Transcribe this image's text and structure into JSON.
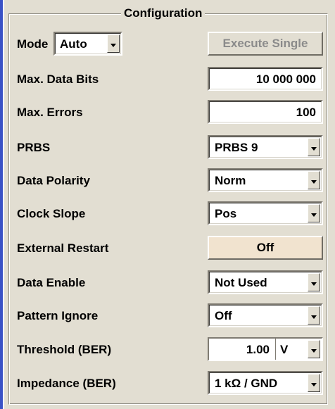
{
  "group": {
    "title": "Configuration"
  },
  "mode": {
    "label": "Mode",
    "value": "Auto"
  },
  "execute_single": {
    "label": "Execute Single"
  },
  "max_data_bits": {
    "label": "Max. Data Bits",
    "value": "10 000 000"
  },
  "max_errors": {
    "label": "Max. Errors",
    "value": "100"
  },
  "prbs": {
    "label": "PRBS",
    "value": "PRBS 9"
  },
  "data_polarity": {
    "label": "Data Polarity",
    "value": "Norm"
  },
  "clock_slope": {
    "label": "Clock Slope",
    "value": "Pos"
  },
  "external_restart": {
    "label": "External Restart",
    "value": "Off"
  },
  "data_enable": {
    "label": "Data Enable",
    "value": "Not Used"
  },
  "pattern_ignore": {
    "label": "Pattern Ignore",
    "value": "Off"
  },
  "threshold": {
    "label": "Threshold (BER)",
    "value": "1.00",
    "unit": "V"
  },
  "impedance": {
    "label": "Impedance (BER)",
    "value": "1 kΩ / GND"
  },
  "colors": {
    "background": "#e2ded2",
    "accent_bar": "#3a52c6",
    "toggle_button": "#f1e3cf",
    "disabled_text": "#8b8b8b"
  },
  "icons": {
    "dropdown": "chevron-down-icon"
  }
}
